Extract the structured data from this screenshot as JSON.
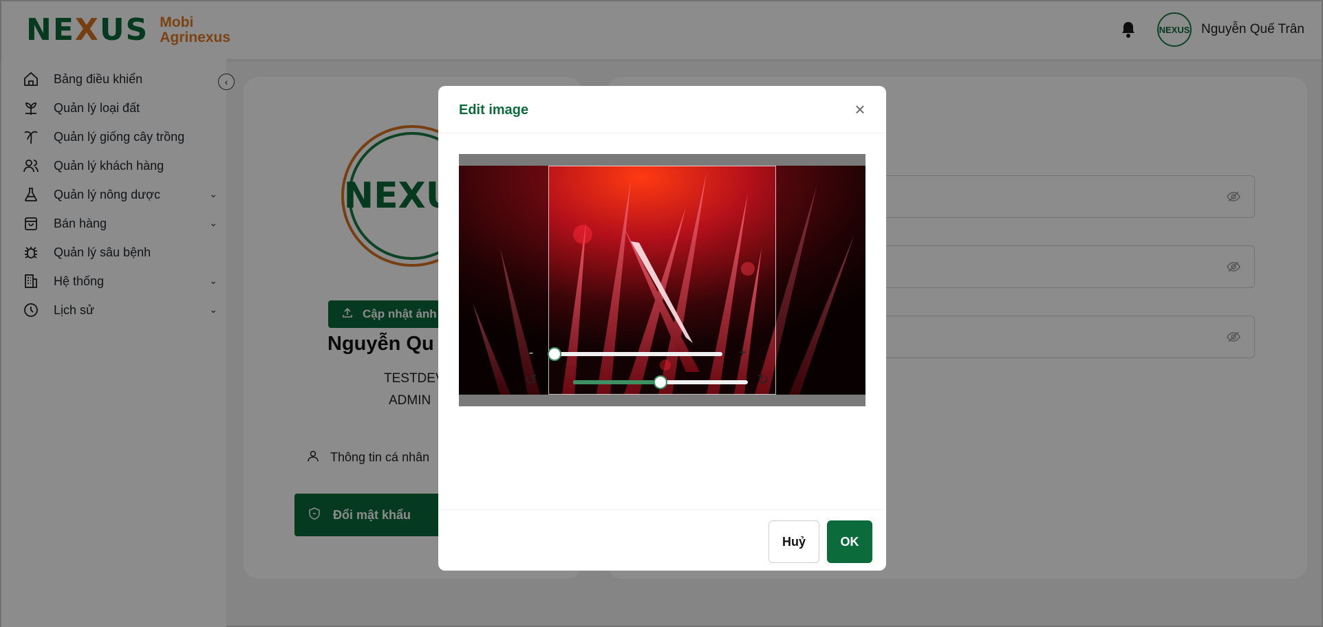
{
  "header": {
    "logo_mark_left": "NE",
    "logo_mark_x": "X",
    "logo_mark_right": "US",
    "logo_line1": "Mobi",
    "logo_line2": "Agrinexus",
    "user_name": "Nguyễn Quế Trân",
    "avatar_text": "NEXUS"
  },
  "sidebar": {
    "items": [
      {
        "label": "Bảng điều khiển",
        "icon": "home-icon",
        "expandable": false
      },
      {
        "label": "Quản lý loại đất",
        "icon": "sprout-icon",
        "expandable": false
      },
      {
        "label": "Quản lý giống cây trồng",
        "icon": "palm-tree-icon",
        "expandable": false
      },
      {
        "label": "Quản lý khách hàng",
        "icon": "users-icon",
        "expandable": false
      },
      {
        "label": "Quản lý nông dược",
        "icon": "flask-icon",
        "expandable": true
      },
      {
        "label": "Bán hàng",
        "icon": "shopping-bag-icon",
        "expandable": true
      },
      {
        "label": "Quản lý sâu bệnh",
        "icon": "bug-icon",
        "expandable": false
      },
      {
        "label": "Hệ thống",
        "icon": "building-icon",
        "expandable": true
      },
      {
        "label": "Lịch sử",
        "icon": "clock-icon",
        "expandable": true
      }
    ]
  },
  "profile": {
    "avatar_text": "NEXUS",
    "upload_label": "Cập nhật ảnh",
    "name": "Nguyễn Qu",
    "code": "TESTDEV",
    "role": "ADMIN",
    "tab_info": "Thông tin cá nhân",
    "tab_password": "Đổi mật khẩu"
  },
  "modal": {
    "title": "Edit image",
    "zoom_minus": "-",
    "zoom_plus": "+",
    "zoom_value": 0.0,
    "rotate_value": 0.5,
    "cancel_label": "Huỷ",
    "ok_label": "OK"
  },
  "colors": {
    "brand_green": "#0b6b3b",
    "brand_orange": "#e07b22",
    "slider_green": "#3c9061"
  }
}
